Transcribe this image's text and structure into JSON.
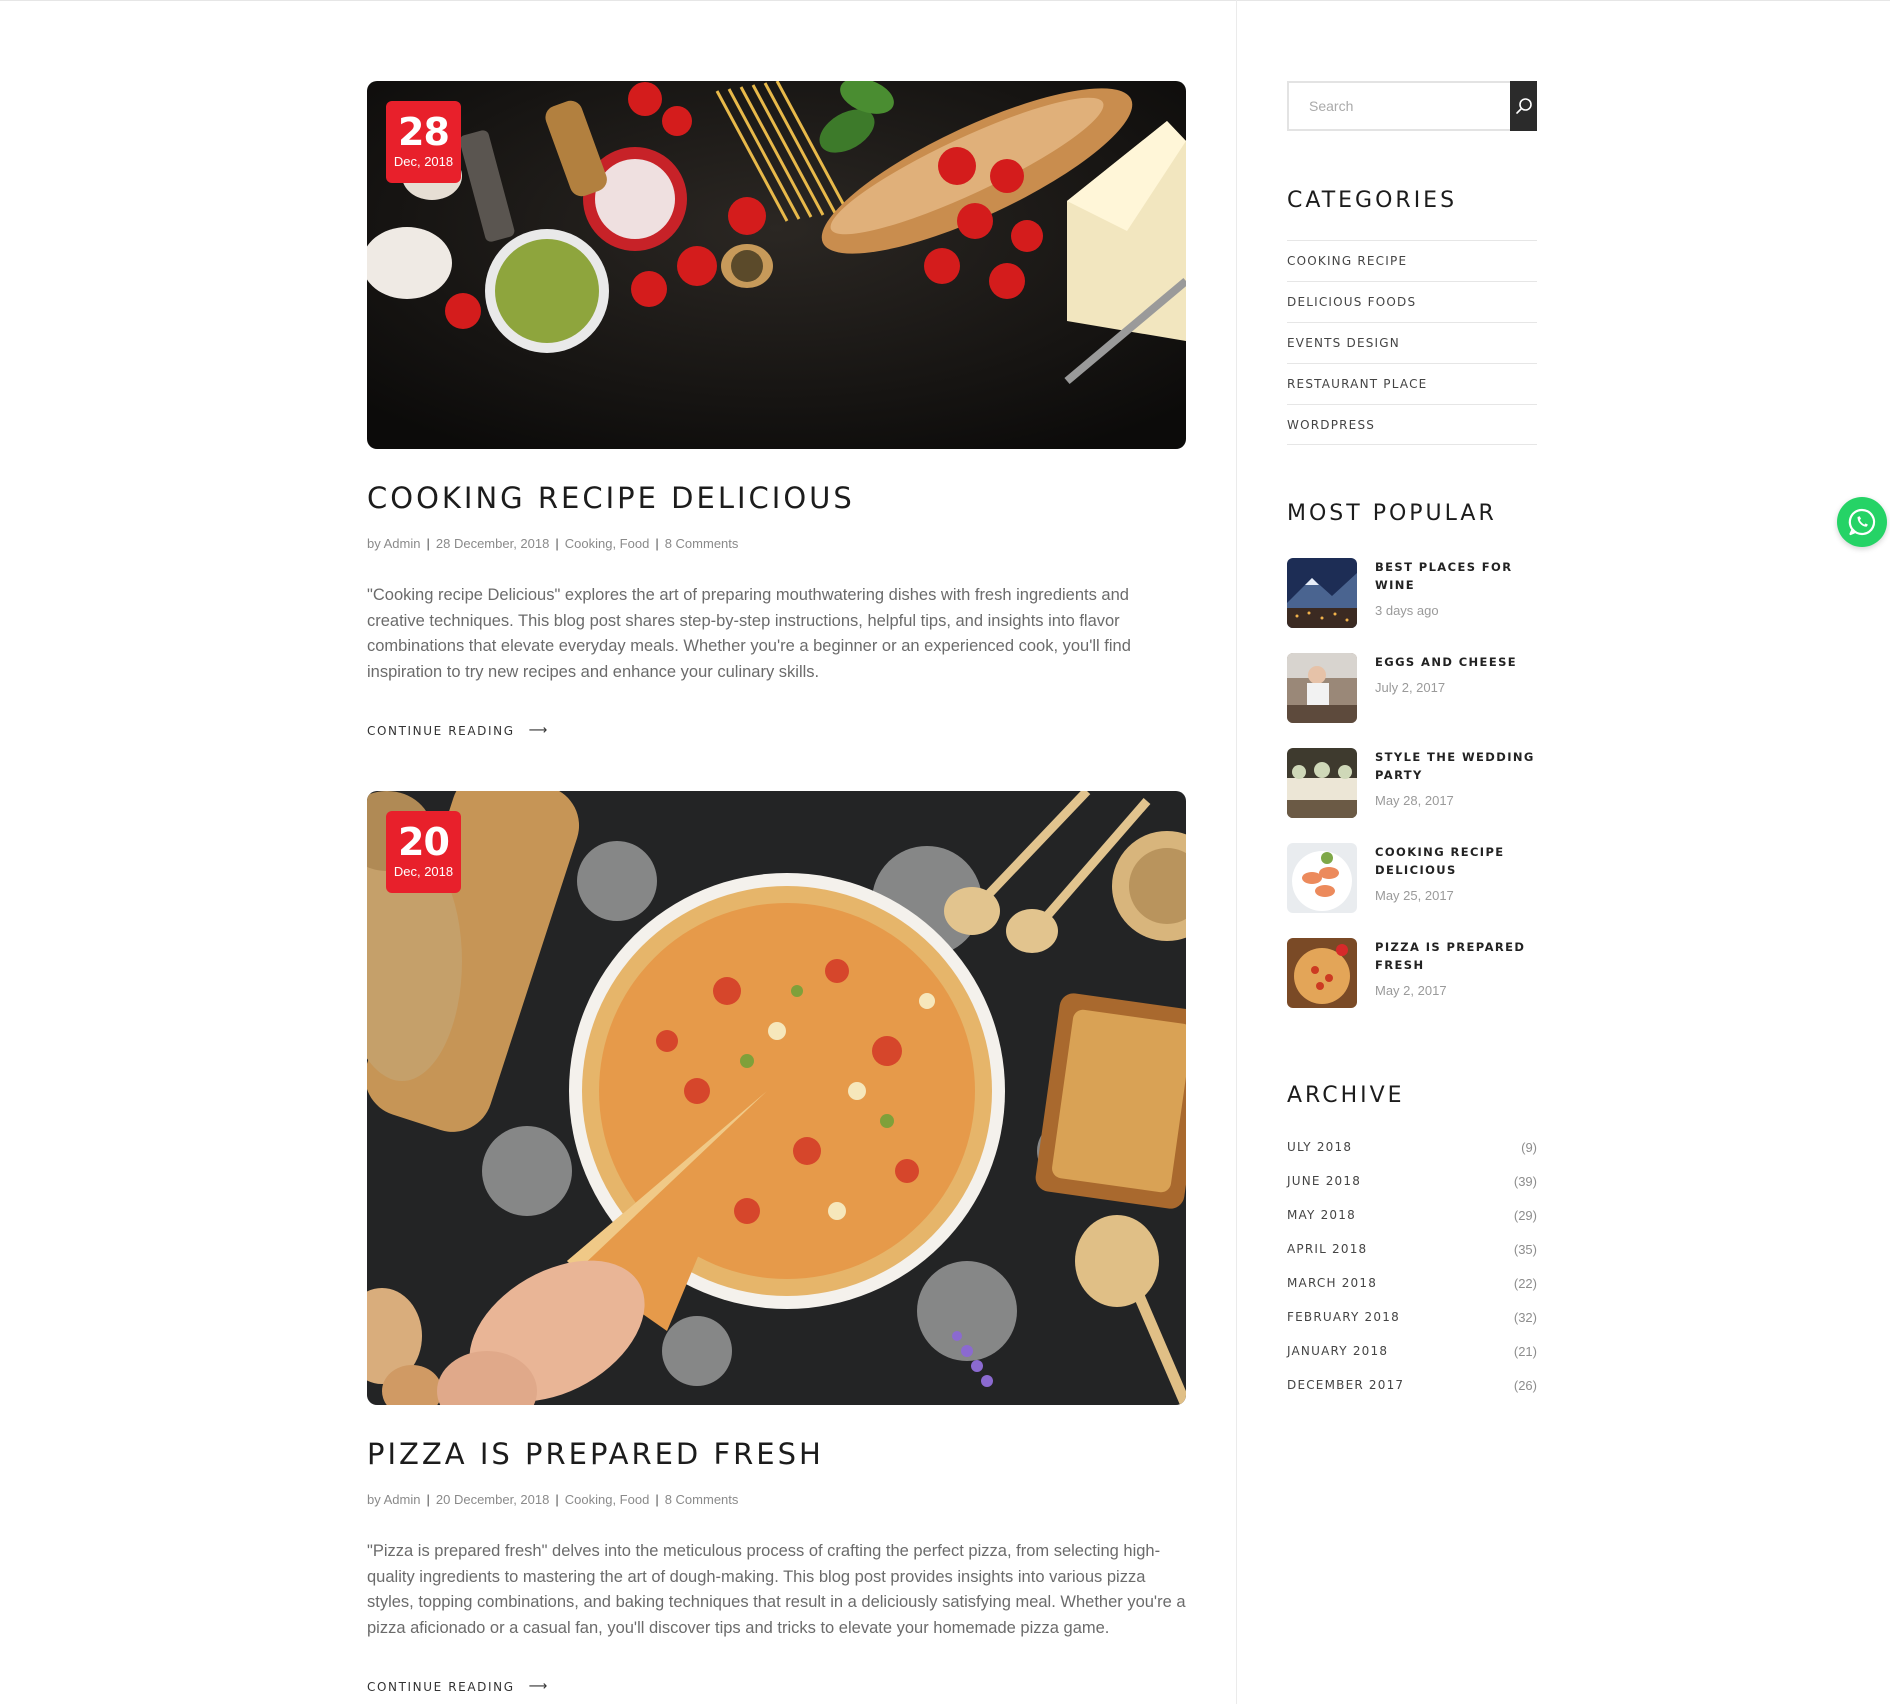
{
  "posts": [
    {
      "day": "28",
      "month": "Dec, 2018",
      "title": "COOKING RECIPE DELICIOUS",
      "meta": {
        "by": "by Admin",
        "date": "28 December, 2018",
        "cat1": "Cooking",
        "cat2": "Food",
        "comments": "8 Comments"
      },
      "excerpt": "\"Cooking recipe Delicious\" explores the art of preparing mouthwatering dishes with fresh ingredients and creative techniques. This blog post shares step-by-step instructions, helpful tips, and insights into flavor combinations that elevate everyday meals. Whether you're a beginner or an experienced cook, you'll find inspiration to try new recipes and enhance your culinary skills.",
      "cta": "CONTINUE READING"
    },
    {
      "day": "20",
      "month": "Dec, 2018",
      "title": "PIZZA IS PREPARED FRESH",
      "meta": {
        "by": "by Admin",
        "date": "20 December, 2018",
        "cat1": "Cooking",
        "cat2": "Food",
        "comments": "8 Comments"
      },
      "excerpt": "\"Pizza is prepared fresh\" delves into the meticulous process of crafting the perfect pizza, from selecting high-quality ingredients to mastering the art of dough-making. This blog post provides insights into various pizza styles, topping combinations, and baking techniques that result in a deliciously satisfying meal. Whether you're a pizza aficionado or a casual fan, you'll discover tips and tricks to elevate your homemade pizza game.",
      "cta": "CONTINUE READING"
    }
  ],
  "sidebar": {
    "search": {
      "placeholder": "Search",
      "icon": "search-icon"
    },
    "categories": {
      "title": "CATEGORIES",
      "items": [
        "COOKING RECIPE",
        "DELICIOUS FOODS",
        "EVENTS DESIGN",
        "RESTAURANT PLACE",
        "WORDPRESS"
      ]
    },
    "popular": {
      "title": "MOST POPULAR",
      "items": [
        {
          "title": "BEST PLACES FOR WINE",
          "date": "3 days ago"
        },
        {
          "title": "EGGS AND CHEESE",
          "date": "July 2, 2017"
        },
        {
          "title": "STYLE THE WEDDING PARTY",
          "date": "May 28, 2017"
        },
        {
          "title": "COOKING RECIPE DELICIOUS",
          "date": "May 25, 2017"
        },
        {
          "title": "PIZZA IS PREPARED FRESH",
          "date": "May 2, 2017"
        }
      ]
    },
    "archive": {
      "title": "ARCHIVE",
      "items": [
        {
          "label": "ULY 2018",
          "count": "(9)"
        },
        {
          "label": "JUNE 2018",
          "count": "(39)"
        },
        {
          "label": "MAY 2018",
          "count": "(29)"
        },
        {
          "label": "APRIL 2018",
          "count": "(35)"
        },
        {
          "label": "MARCH 2018",
          "count": "(22)"
        },
        {
          "label": "FEBRUARY 2018",
          "count": "(32)"
        },
        {
          "label": "JANUARY 2018",
          "count": "(21)"
        },
        {
          "label": "DECEMBER 2017",
          "count": "(26)"
        }
      ]
    }
  },
  "colors": {
    "accent": "#e8202b",
    "whatsapp": "#25d366",
    "search_button": "#2b2b2b"
  },
  "icons": {
    "arrow": "arrow-right-icon",
    "whatsapp": "whatsapp-icon"
  }
}
